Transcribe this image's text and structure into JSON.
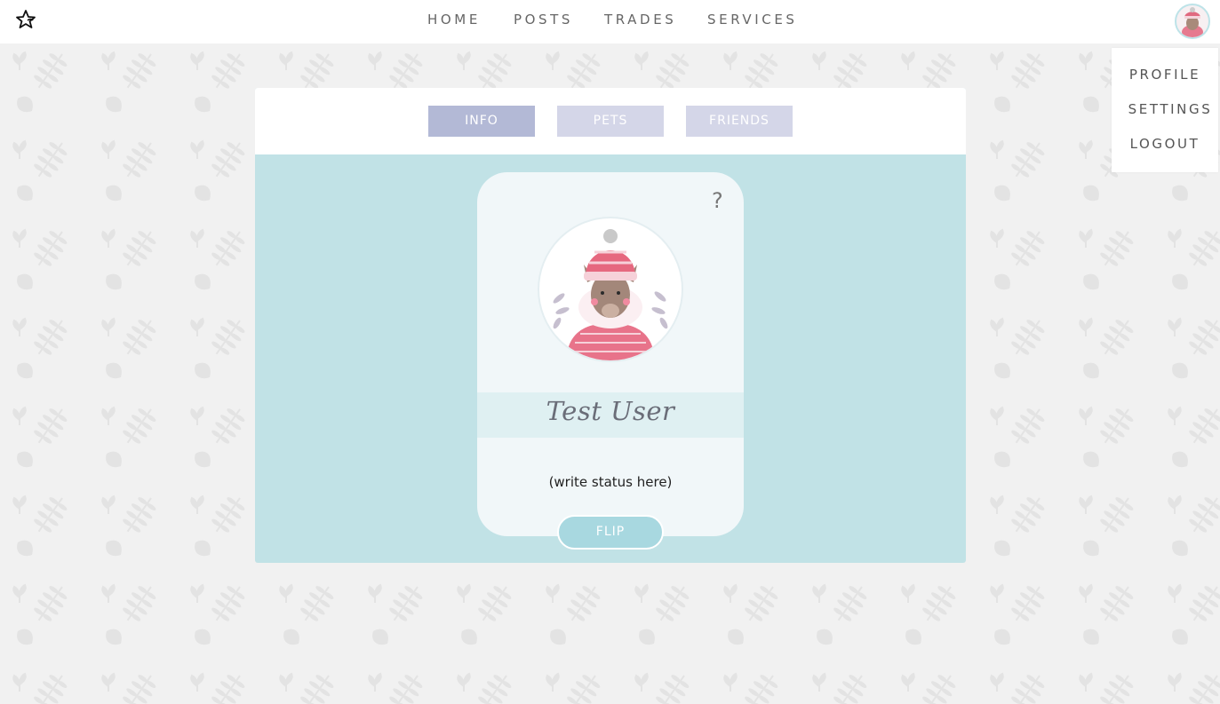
{
  "nav": {
    "home": "HOME",
    "posts": "POSTS",
    "trades": "TRADES",
    "services": "SERVICES"
  },
  "logo_icon": "star-pet-icon",
  "user_menu": {
    "profile": "PROFILE",
    "settings": "SETTINGS",
    "logout": "LOGOUT"
  },
  "profile_tabs": {
    "info": "INFO",
    "pets": "PETS",
    "friends": "FRIENDS",
    "active": "INFO"
  },
  "profile_card": {
    "help_icon": "?",
    "username": "Test User",
    "status": "(write status here)",
    "flip_label": "FLIP",
    "avatar_icon": "llama-with-hat-avatar"
  },
  "colors": {
    "panel": "#c1e2e6",
    "tab_active": "#b3b9d6",
    "tab_inactive": "#d4d6e8",
    "card": "#f1f7f9",
    "name_band": "#dff0f2",
    "flip_button": "#a8d8e0",
    "page_background": "#f1f1f1"
  }
}
